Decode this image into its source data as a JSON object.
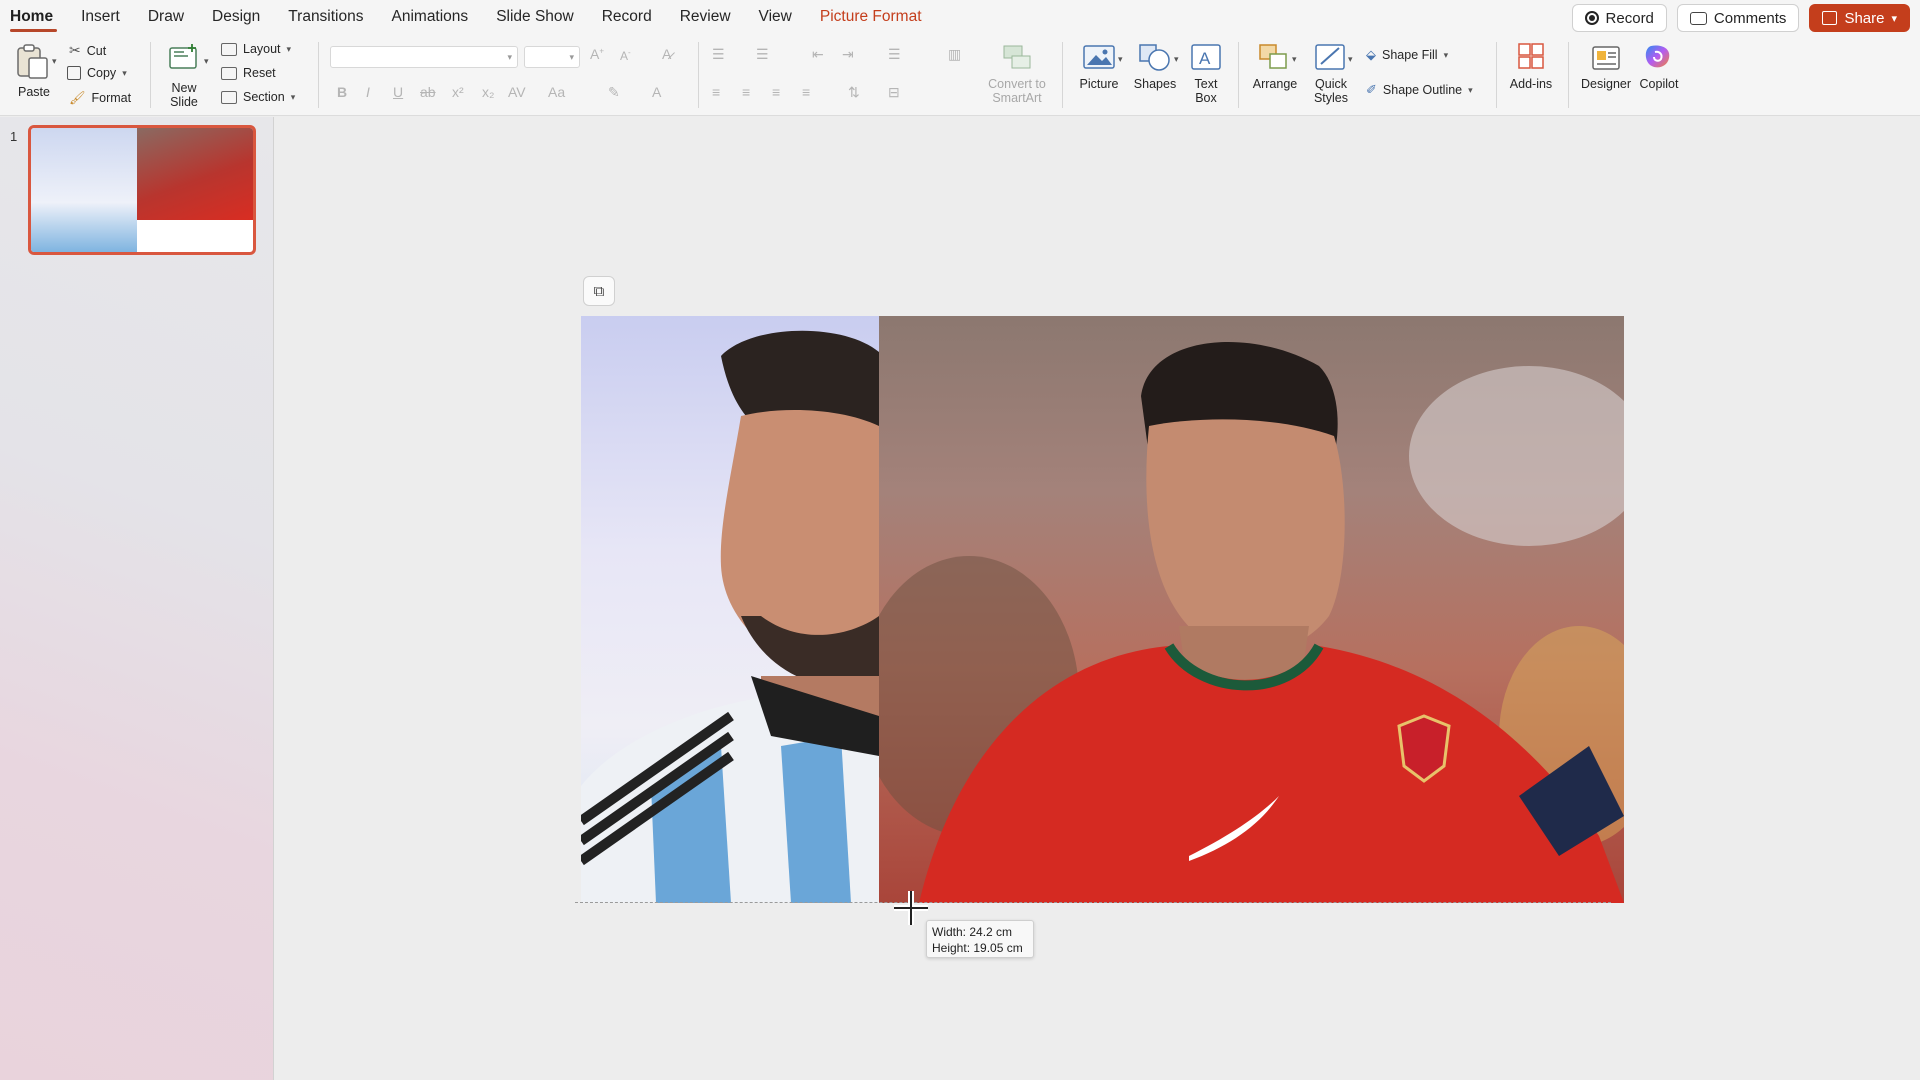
{
  "tabs": [
    {
      "label": "Home",
      "active": true
    },
    {
      "label": "Insert"
    },
    {
      "label": "Draw"
    },
    {
      "label": "Design"
    },
    {
      "label": "Transitions"
    },
    {
      "label": "Animations"
    },
    {
      "label": "Slide Show"
    },
    {
      "label": "Record"
    },
    {
      "label": "Review"
    },
    {
      "label": "View"
    },
    {
      "label": "Picture Format",
      "contextual": true
    }
  ],
  "top_right": {
    "record_label": "Record",
    "comments_label": "Comments",
    "share_label": "Share"
  },
  "ribbon": {
    "paste": "Paste",
    "cut": "Cut",
    "copy": "Copy",
    "format": "Format",
    "new_slide_1": "New",
    "new_slide_2": "Slide",
    "layout": "Layout",
    "reset": "Reset",
    "section": "Section",
    "convert_1": "Convert to",
    "convert_2": "SmartArt",
    "picture": "Picture",
    "shapes": "Shapes",
    "text_box_1": "Text",
    "text_box_2": "Box",
    "arrange": "Arrange",
    "quick_styles_1": "Quick",
    "quick_styles_2": "Styles",
    "shape_fill": "Shape Fill",
    "shape_outline": "Shape Outline",
    "add_ins": "Add-ins",
    "designer": "Designer",
    "copilot": "Copilot"
  },
  "thumbnails": {
    "slide_number": "1"
  },
  "tooltip": {
    "width": "Width: 24.2 cm",
    "height": "Height: 19.05 cm"
  },
  "colors": {
    "accent": "#c43e1c",
    "thumb_border": "#d9573f"
  }
}
